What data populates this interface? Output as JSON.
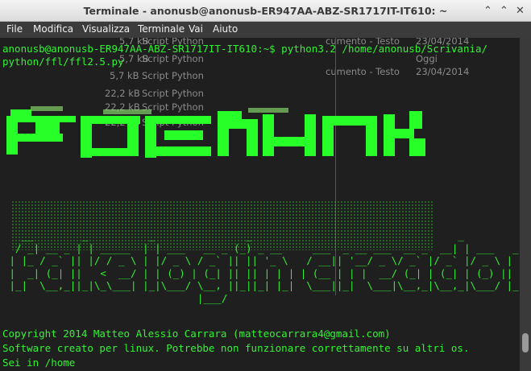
{
  "window": {
    "title": "Terminale - anonusb@anonusb-ER947AA-ABZ-SR1717IT-IT610: ~",
    "minimize_glyph": "⌃",
    "maximize_glyph": "⌃",
    "close_glyph": "✕"
  },
  "menu": {
    "items": [
      "File",
      "Modifica",
      "Visualizza",
      "Terminale",
      "Vai",
      "Aiuto"
    ]
  },
  "background_window": {
    "rows": [
      {
        "size": "5,7 kB",
        "type": "Script Python"
      },
      {
        "size": "5,7 kB",
        "type": "Script Python"
      },
      {
        "size": "5,7 kB",
        "type": "Script Python"
      },
      {
        "size": "22,2 kB",
        "type": "Script Python"
      },
      {
        "size": "22,2 kB",
        "type": "Script Python"
      },
      {
        "size": "22,2 kB",
        "type": "Script Python"
      }
    ],
    "right_items": [
      "cumento - Testo",
      "Oggi",
      "cumento - Testo",
      "23/04/2014",
      "23/04/2014"
    ]
  },
  "terminal": {
    "prompt_line1": "anonusb@anonusb-ER947AA-ABZ-SR1717IT-IT610:~$ python3.2 /home/anonusb/Scrivania/",
    "prompt_line2": "python/ffl/ffl2.5.py",
    "art_lines": [
      "   __        _          _               _                                  _",
      "  / _| __ _ | | _____  | | ___   __ _ (_) _ __     ___  _ __ ___  __ _  __| | ___   _ __",
      " | |_ / _` || |/ / _ \\ | |/ _ \\ / _` || || '_ \\   / __|| '__/ _ \\/ _` |/ _` |/ _ \\ | '__|",
      " |  _| (_| ||   <  __/ | | (_) | (_| || || | | | | (__ | | |  __/ (_| | (_| | (_) || |",
      " |_|  \\__,_||_|\\_\\___| |_|\\___/ \\__, ||_||_| |_|  \\___||_|  \\___|\\__,_|\\__,_|\\___/ |_|",
      "                                |___/"
    ],
    "copyright": "Copyright 2014 Matteo Alessio Carrara (matteocarrara4@gmail.com)",
    "warning": "Software creato per linux. Potrebbe non funzionare correttamente su altri os.",
    "cwd": "Sei in /home"
  }
}
